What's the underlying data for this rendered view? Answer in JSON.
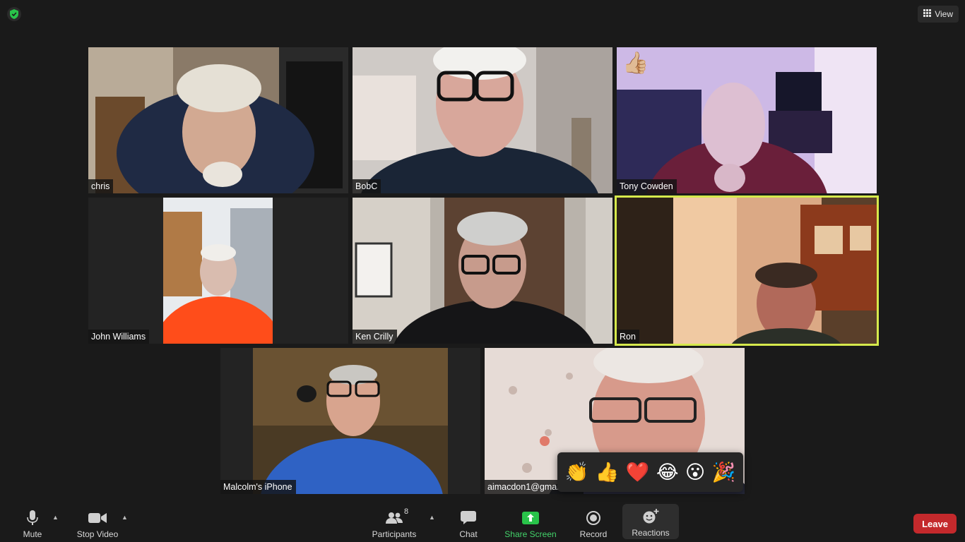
{
  "header": {
    "view_label": "View"
  },
  "participants": [
    {
      "name": "chris"
    },
    {
      "name": "BobC"
    },
    {
      "name": "Tony Cowden",
      "reaction": "👍🏼"
    },
    {
      "name": "John Williams"
    },
    {
      "name": "Ken Crilly"
    },
    {
      "name": "Ron",
      "speaking": true
    },
    {
      "name": "Malcolm's iPhone"
    },
    {
      "name": "aimacdon1@gmail.com"
    }
  ],
  "reactions": [
    "👏",
    "👍",
    "❤️",
    "😂",
    "😮",
    "🎉"
  ],
  "toolbar": {
    "mute": "Mute",
    "stop_video": "Stop Video",
    "participants": "Participants",
    "participant_count": "8",
    "chat": "Chat",
    "share_screen": "Share Screen",
    "record": "Record",
    "reactions": "Reactions",
    "leave": "Leave"
  },
  "colors": {
    "speaking_outline": "#d6e94c",
    "share_green": "#43d36a",
    "leave_red": "#c4292c"
  }
}
